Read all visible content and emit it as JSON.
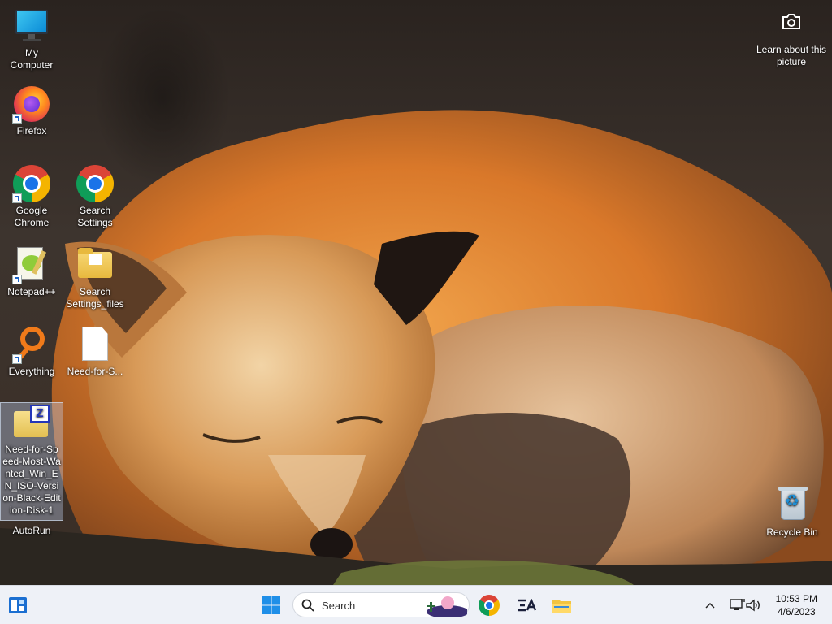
{
  "desktop": {
    "icons": {
      "my_computer": "My Computer",
      "firefox": "Firefox",
      "google_chrome": "Google Chrome",
      "search_settings": "Search Settings",
      "notepadpp": "Notepad++",
      "search_settings_files": "Search Settings_files",
      "everything": "Everything",
      "need_for_speed_file": "Need-for-S...",
      "nfs_iso": "Need-for-Speed-Most-Wanted_Win_EN_ISO-Version-Black-Edition-Disk-1",
      "autorun": "AutoRun",
      "recycle_bin": "Recycle Bin"
    },
    "learn_about_picture": "Learn about this picture"
  },
  "taskbar": {
    "search_placeholder": "Search",
    "time": "10:53 PM",
    "date": "4/6/2023"
  }
}
